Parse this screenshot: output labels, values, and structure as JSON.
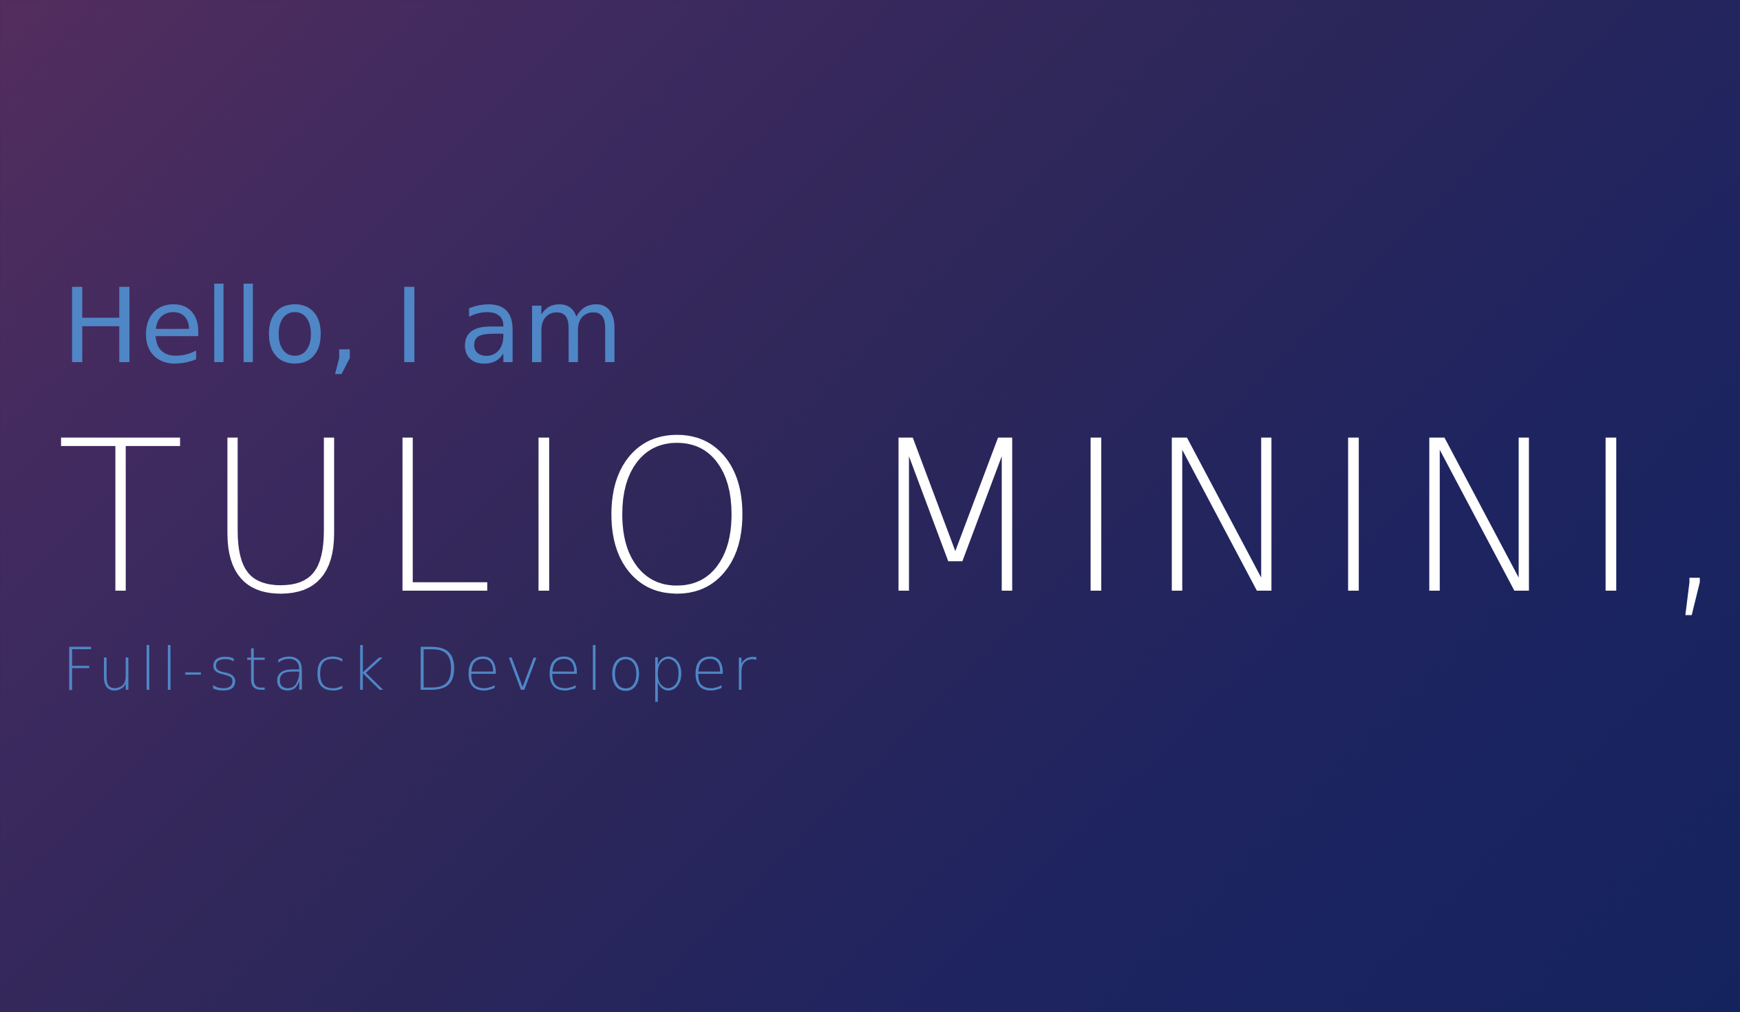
{
  "hero": {
    "greeting": "Hello, I am",
    "name": "TULIO MININI,",
    "role": "Full-stack Developer"
  },
  "theme": {
    "accent_color": "#4f86c6",
    "name_color": "#ffffff",
    "background_gradient": [
      "#532d5e",
      "#2e2759",
      "#14235e"
    ]
  }
}
